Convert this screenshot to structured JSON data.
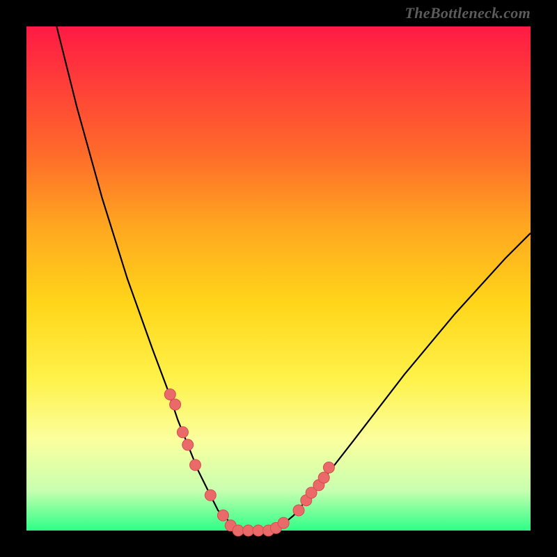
{
  "watermark": "TheBottleneck.com",
  "chart_data": {
    "type": "line",
    "title": "",
    "xlabel": "",
    "ylabel": "",
    "xlim": [
      0,
      100
    ],
    "ylim": [
      0,
      100
    ],
    "grid": false,
    "legend": false,
    "series": [
      {
        "name": "curve",
        "x": [
          6,
          10,
          15,
          20,
          25,
          28,
          30,
          32,
          34,
          36,
          38,
          42,
          44,
          46,
          48,
          50,
          53,
          58,
          65,
          75,
          85,
          95,
          100
        ],
        "y": [
          100,
          84,
          66,
          50,
          36,
          28,
          22,
          17,
          12,
          8,
          4,
          0,
          0,
          0,
          0,
          0.5,
          3,
          9,
          18,
          31,
          43,
          54,
          59
        ]
      }
    ],
    "markers": {
      "name": "sample-points",
      "x": [
        28.5,
        29.5,
        31.0,
        32.0,
        33.5,
        36.5,
        39.0,
        40.5,
        42.0,
        44.0,
        46.0,
        48.0,
        49.5,
        51.0,
        54.0,
        55.5,
        56.5,
        58.0,
        59.0,
        60.0
      ],
      "y": [
        27.0,
        25.0,
        19.5,
        17.0,
        13.0,
        7.0,
        3.0,
        1.0,
        0.0,
        0.0,
        0.0,
        0.0,
        0.5,
        1.5,
        4.0,
        6.0,
        7.5,
        9.0,
        10.5,
        12.5
      ]
    },
    "colors": {
      "curve_stroke": "#000000",
      "marker_fill": "#ea6a6a",
      "marker_stroke": "#d44e4e",
      "gradient_top": "#ff1a44",
      "gradient_bottom": "#2dff86"
    }
  }
}
